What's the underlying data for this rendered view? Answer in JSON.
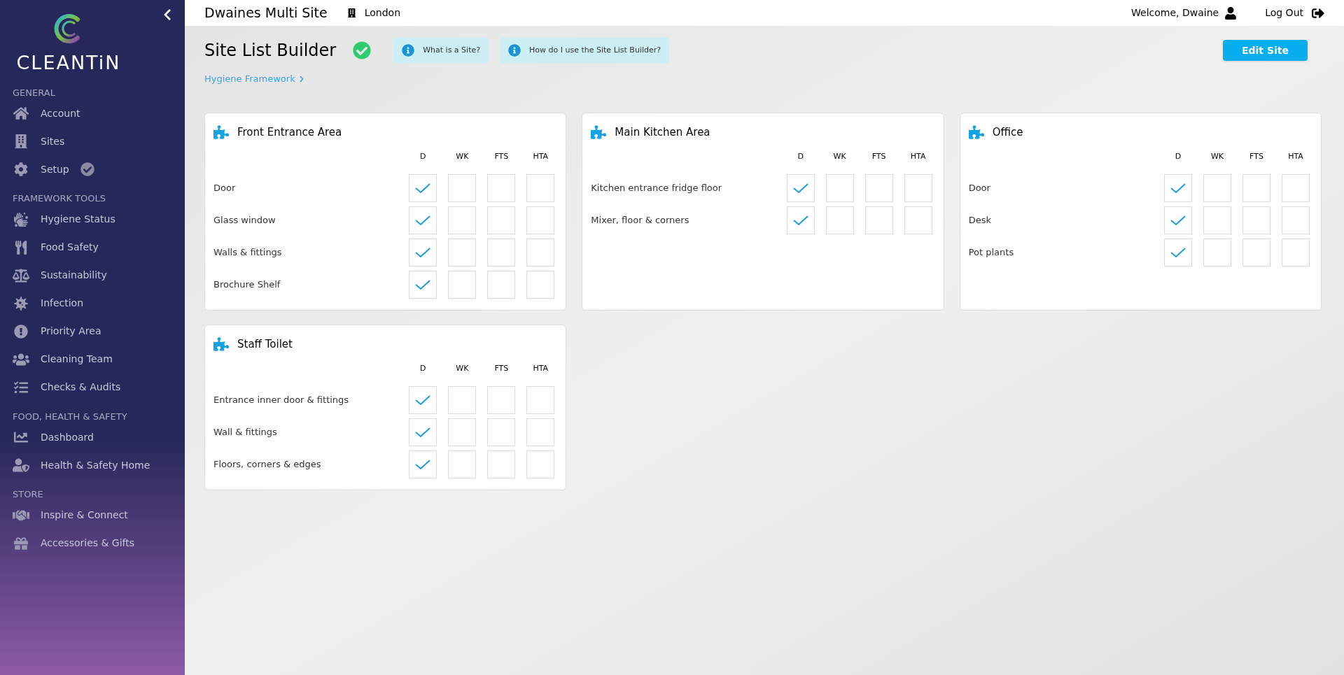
{
  "sidebar": {
    "logo": "CLEANTiN",
    "sections": [
      {
        "heading": "GENERAL",
        "items": [
          {
            "label": "Account",
            "done": false
          },
          {
            "label": "Sites",
            "done": false
          },
          {
            "label": "Setup",
            "done": true
          }
        ]
      },
      {
        "heading": "FRAMEWORK TOOLS",
        "items": [
          {
            "label": "Hygiene Status",
            "done": false
          },
          {
            "label": "Food Safety",
            "done": false
          },
          {
            "label": "Sustainability",
            "done": false
          },
          {
            "label": "Infection",
            "done": false
          },
          {
            "label": "Priority Area",
            "done": false
          },
          {
            "label": "Cleaning Team",
            "done": false
          },
          {
            "label": "Checks & Audits",
            "done": false
          }
        ]
      },
      {
        "heading": "FOOD, HEALTH & SAFETY",
        "items": [
          {
            "label": "Dashboard",
            "done": false
          },
          {
            "label": "Health & Safety Home",
            "done": false
          }
        ]
      },
      {
        "heading": "STORE",
        "items": [
          {
            "label": "Inspire & Connect",
            "done": false
          },
          {
            "label": "Accessories & Gifts",
            "done": false
          }
        ]
      }
    ]
  },
  "topbar": {
    "site": "Dwaines Multi Site",
    "location": "London",
    "welcome": "Welcome, Dwaine",
    "logout": "Log Out"
  },
  "page": {
    "title": "Site List Builder",
    "complete": true,
    "help": [
      "What is a Site?",
      "How do I use the Site List Builder?"
    ],
    "edit_button": "Edit Site",
    "breadcrumb": "Hygiene Framework"
  },
  "areas": [
    {
      "name": "Front Entrance Area",
      "columns": [
        "D",
        "WK",
        "FTS",
        "HTA"
      ],
      "rows": [
        {
          "label": "Door",
          "checks": [
            true,
            false,
            false,
            false
          ]
        },
        {
          "label": "Glass window",
          "checks": [
            true,
            false,
            false,
            false
          ]
        },
        {
          "label": "Walls & fittings",
          "checks": [
            true,
            false,
            false,
            false
          ]
        },
        {
          "label": "Brochure Shelf",
          "checks": [
            true,
            false,
            false,
            false
          ]
        }
      ]
    },
    {
      "name": "Main Kitchen Area",
      "columns": [
        "D",
        "WK",
        "FTS",
        "HTA"
      ],
      "rows": [
        {
          "label": "Kitchen entrance fridge floor",
          "checks": [
            true,
            false,
            false,
            false
          ]
        },
        {
          "label": "Mixer, floor & corners",
          "checks": [
            true,
            false,
            false,
            false
          ]
        }
      ]
    },
    {
      "name": "Office",
      "columns": [
        "D",
        "WK",
        "FTS",
        "HTA"
      ],
      "rows": [
        {
          "label": "Door",
          "checks": [
            true,
            false,
            false,
            false
          ]
        },
        {
          "label": "Desk",
          "checks": [
            true,
            false,
            false,
            false
          ]
        },
        {
          "label": "Pot plants",
          "checks": [
            true,
            false,
            false,
            false
          ]
        }
      ]
    },
    {
      "name": "Staff Toilet",
      "columns": [
        "D",
        "WK",
        "FTS",
        "HTA"
      ],
      "rows": [
        {
          "label": "Entrance inner door & fittings",
          "checks": [
            true,
            false,
            false,
            false
          ]
        },
        {
          "label": "Wall & fittings",
          "checks": [
            true,
            false,
            false,
            false
          ]
        },
        {
          "label": "Floors, corners & edges",
          "checks": [
            true,
            false,
            false,
            false
          ]
        }
      ]
    }
  ]
}
